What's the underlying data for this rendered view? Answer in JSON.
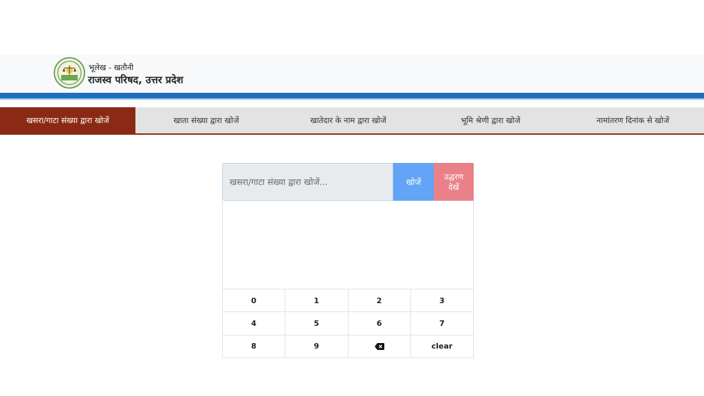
{
  "header": {
    "logo_icon": "emblem-seal-icon",
    "subtitle": "भूलेख - खतौनी",
    "title": "राजस्व परिषद, उत्तर प्रदेश"
  },
  "tabs": [
    {
      "label": "खसरा/गाटा संख्या द्वारा खोजें",
      "active": true
    },
    {
      "label": "खाता संख्या द्वारा खोजें",
      "active": false
    },
    {
      "label": "खातेदार के नाम द्वारा खोजें",
      "active": false
    },
    {
      "label": "भूमि श्रेणी द्वारा खोजें",
      "active": false
    },
    {
      "label": "नामांतरण दिनांक से खोजें",
      "active": false
    }
  ],
  "search": {
    "placeholder": "खसरा/गाटा संख्या द्वारा खोजें...",
    "value": "",
    "search_button": "खोजें",
    "view_button_line1": "उद्धरण",
    "view_button_line2": "देखें"
  },
  "keypad": {
    "keys": [
      "0",
      "1",
      "2",
      "3",
      "4",
      "5",
      "6",
      "7",
      "8",
      "9"
    ],
    "backspace_icon": "backspace-icon",
    "clear_label": "clear"
  },
  "colors": {
    "active_tab": "#8b2a14",
    "tab_bar": "#e3e3e3",
    "blue_bar": "#1e6fc0",
    "search_button": "#62a4f5",
    "view_button": "#ea8088"
  }
}
